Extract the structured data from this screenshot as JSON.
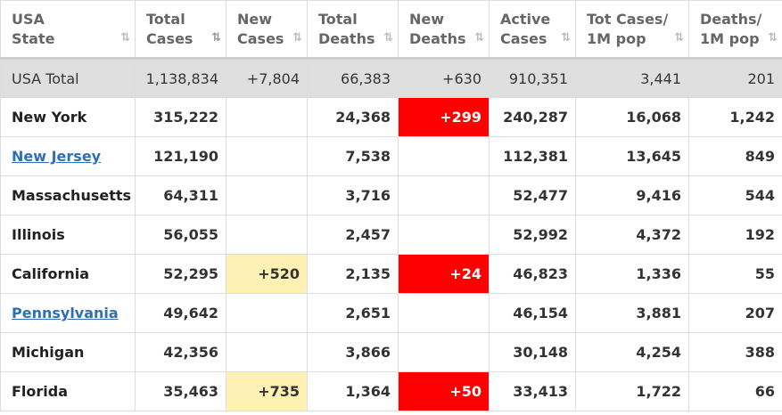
{
  "headers": [
    {
      "line1": "USA",
      "line2": "State",
      "sort": "⇅",
      "active": false
    },
    {
      "line1": "Total",
      "line2": "Cases",
      "sort": "⇅",
      "active": true
    },
    {
      "line1": "New",
      "line2": "Cases",
      "sort": "⇅",
      "active": false
    },
    {
      "line1": "Total",
      "line2": "Deaths",
      "sort": "⇅",
      "active": false
    },
    {
      "line1": "New",
      "line2": "Deaths",
      "sort": "⇅",
      "active": false
    },
    {
      "line1": "Active",
      "line2": "Cases",
      "sort": "⇅",
      "active": false
    },
    {
      "line1": "Tot Cases/",
      "line2": "1M pop",
      "sort": "⇅",
      "active": false
    },
    {
      "line1": "Deaths/",
      "line2": "1M pop",
      "sort": "⇅",
      "active": false
    }
  ],
  "total_row": {
    "state": "USA Total",
    "total_cases": "1,138,834",
    "new_cases": "+7,804",
    "total_deaths": "66,383",
    "new_deaths": "+630",
    "active_cases": "910,351",
    "cases_per_1m": "3,441",
    "deaths_per_1m": "201"
  },
  "rows": [
    {
      "state": "New York",
      "link": false,
      "total_cases": "315,222",
      "new_cases": "",
      "total_deaths": "24,368",
      "new_deaths": "+299",
      "active_cases": "240,287",
      "cases_per_1m": "16,068",
      "deaths_per_1m": "1,242"
    },
    {
      "state": "New Jersey",
      "link": true,
      "total_cases": "121,190",
      "new_cases": "",
      "total_deaths": "7,538",
      "new_deaths": "",
      "active_cases": "112,381",
      "cases_per_1m": "13,645",
      "deaths_per_1m": "849"
    },
    {
      "state": "Massachusetts",
      "link": false,
      "total_cases": "64,311",
      "new_cases": "",
      "total_deaths": "3,716",
      "new_deaths": "",
      "active_cases": "52,477",
      "cases_per_1m": "9,416",
      "deaths_per_1m": "544"
    },
    {
      "state": "Illinois",
      "link": false,
      "total_cases": "56,055",
      "new_cases": "",
      "total_deaths": "2,457",
      "new_deaths": "",
      "active_cases": "52,992",
      "cases_per_1m": "4,372",
      "deaths_per_1m": "192"
    },
    {
      "state": "California",
      "link": false,
      "total_cases": "52,295",
      "new_cases": "+520",
      "total_deaths": "2,135",
      "new_deaths": "+24",
      "active_cases": "46,823",
      "cases_per_1m": "1,336",
      "deaths_per_1m": "55"
    },
    {
      "state": "Pennsylvania",
      "link": true,
      "total_cases": "49,642",
      "new_cases": "",
      "total_deaths": "2,651",
      "new_deaths": "",
      "active_cases": "46,154",
      "cases_per_1m": "3,881",
      "deaths_per_1m": "207"
    },
    {
      "state": "Michigan",
      "link": false,
      "total_cases": "42,356",
      "new_cases": "",
      "total_deaths": "3,866",
      "new_deaths": "",
      "active_cases": "30,148",
      "cases_per_1m": "4,254",
      "deaths_per_1m": "388"
    },
    {
      "state": "Florida",
      "link": false,
      "total_cases": "35,463",
      "new_cases": "+735",
      "total_deaths": "1,364",
      "new_deaths": "+50",
      "active_cases": "33,413",
      "cases_per_1m": "1,722",
      "deaths_per_1m": "66"
    }
  ],
  "colors": {
    "new_cases_highlight": "#fff0b3",
    "new_deaths_highlight": "#ff0000",
    "total_row_bg": "#dfdfdf",
    "link": "#2f6fb3"
  }
}
